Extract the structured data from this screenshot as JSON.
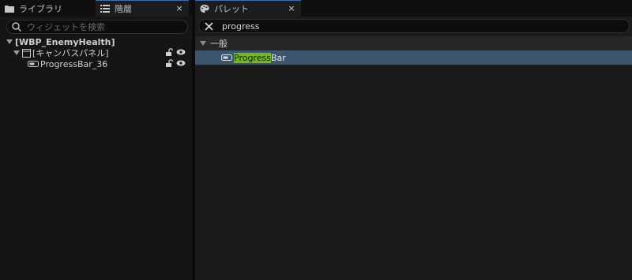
{
  "left_panel": {
    "tabs": [
      {
        "label": "ライブラリ",
        "icon": "folder-icon"
      },
      {
        "label": "階層",
        "icon": "hierarchy-list-icon",
        "close": "×"
      }
    ],
    "search": {
      "placeholder": "ウィジェットを検索"
    },
    "tree": [
      {
        "label": "[WBP_EnemyHealth]",
        "expanded": true
      },
      {
        "label": "[キャンバスパネル]",
        "expanded": true,
        "icon": "canvas-panel-icon"
      },
      {
        "label": "ProgressBar_36",
        "icon": "progress-bar-icon"
      }
    ]
  },
  "right_panel": {
    "tab": {
      "label": "パレット",
      "icon": "palette-icon",
      "close": "×"
    },
    "search": {
      "value": "progress"
    },
    "category": {
      "label": "一般"
    },
    "item": {
      "highlight": "Progress",
      "rest": "Bar",
      "icon": "progress-bar-icon"
    }
  },
  "colors": {
    "accent_tab": "#3a6fb8",
    "selection": "#3d5670",
    "search_highlight": "#74b91c"
  }
}
